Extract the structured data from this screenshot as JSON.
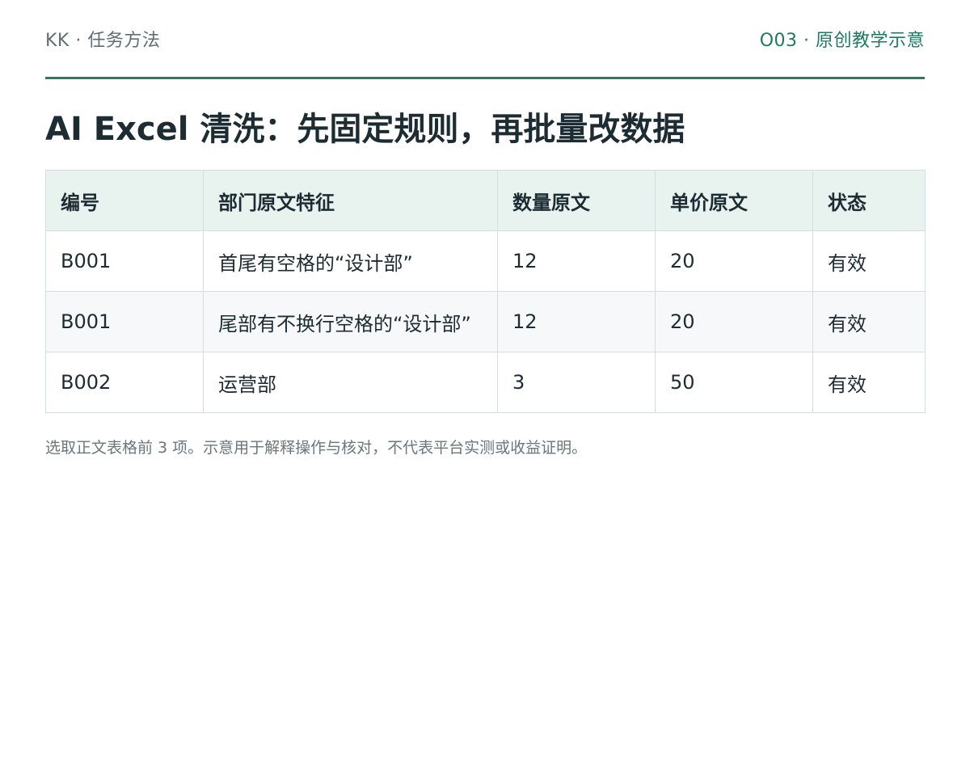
{
  "header": {
    "brand": "KK · 任务方法",
    "tag": "O03 · 原创教学示意"
  },
  "title": "AI Excel 清洗：先固定规则，再批量改数据",
  "table": {
    "columns": [
      "编号",
      "部门原文特征",
      "数量原文",
      "单价原文",
      "状态"
    ],
    "rows": [
      [
        "B001",
        "首尾有空格的“设计部”",
        "12",
        "20",
        "有效"
      ],
      [
        "B001",
        "尾部有不换行空格的“设计部”",
        "12",
        "20",
        "有效"
      ],
      [
        "B002",
        "运营部",
        "3",
        "50",
        "有效"
      ]
    ]
  },
  "footnote": "选取正文表格前 3 项。示意用于解释操作与核对，不代表平台实测或收益证明。",
  "colors": {
    "accent": "#2a7a66",
    "tag_text": "#1f7a5f",
    "header_bg": "#e8f3ef",
    "border": "#d6dde0"
  }
}
